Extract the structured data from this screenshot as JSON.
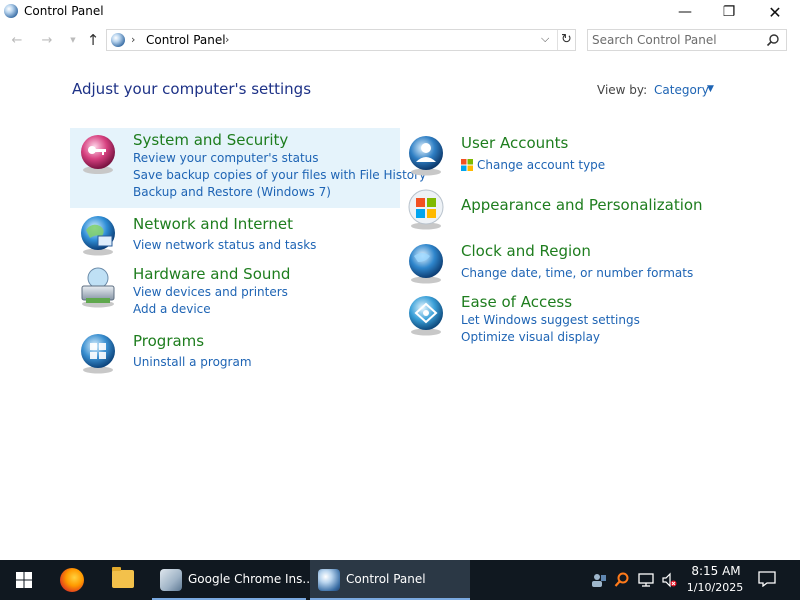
{
  "window": {
    "title": "Control Panel",
    "minimize_glyph": "—",
    "maximize_glyph": "❐",
    "close_glyph": "✕"
  },
  "nav": {
    "back_glyph": "←",
    "forward_glyph": "→",
    "recent_glyph": "▼",
    "up_glyph": "↑",
    "breadcrumb_separator": "›",
    "breadcrumb": "Control Panel",
    "dropdown_glyph": "⌵",
    "refresh_glyph": "↻",
    "search_placeholder": "Search Control Panel"
  },
  "content": {
    "heading": "Adjust your computer's settings",
    "view_by_label": "View by:",
    "view_by_value": "Category",
    "view_by_caret": "▼"
  },
  "categories_left": [
    {
      "title": "System and Security",
      "links": [
        "Review your computer's status",
        "Save backup copies of your files with File History",
        "Backup and Restore (Windows 7)"
      ]
    },
    {
      "title": "Network and Internet",
      "links": [
        "View network status and tasks"
      ]
    },
    {
      "title": "Hardware and Sound",
      "links": [
        "View devices and printers",
        "Add a device"
      ]
    },
    {
      "title": "Programs",
      "links": [
        "Uninstall a program"
      ]
    }
  ],
  "categories_right": [
    {
      "title": "User Accounts",
      "links": [
        "Change account type"
      ]
    },
    {
      "title": "Appearance and Personalization",
      "links": []
    },
    {
      "title": "Clock and Region",
      "links": [
        "Change date, time, or number formats"
      ]
    },
    {
      "title": "Ease of Access",
      "links": [
        "Let Windows suggest settings",
        "Optimize visual display"
      ]
    }
  ],
  "taskbar": {
    "tasks": [
      "Google Chrome Ins...",
      "Control Panel"
    ],
    "time": "8:15 AM",
    "date": "1/10/2025"
  },
  "colors": {
    "title_green": "#1e7d1e",
    "link_blue": "#1e64b4",
    "heading_blue": "#1e3287",
    "highlight": "#e5f3fb",
    "taskbar": "#101820"
  }
}
